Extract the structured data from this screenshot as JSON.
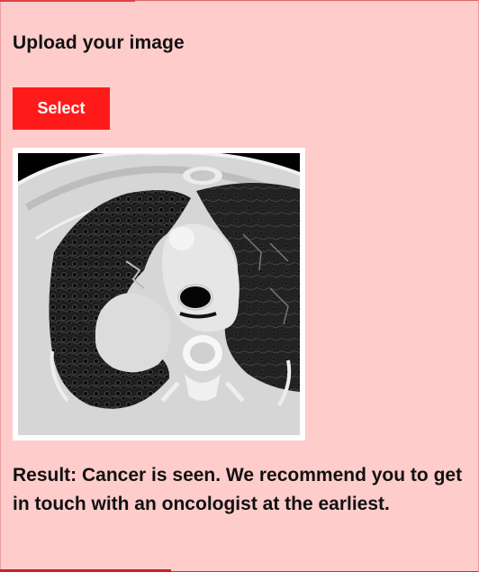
{
  "upload": {
    "title": "Upload your image",
    "select_label": "Select"
  },
  "image": {
    "subject": "chest-ct-scan"
  },
  "result": {
    "text": "Result: Cancer is seen. We recommend you to get in touch with an oncologist at the earliest."
  },
  "colors": {
    "background": "#ffcccc",
    "button": "#ff1a1a",
    "button_text": "#ffffff",
    "text": "#111111"
  }
}
